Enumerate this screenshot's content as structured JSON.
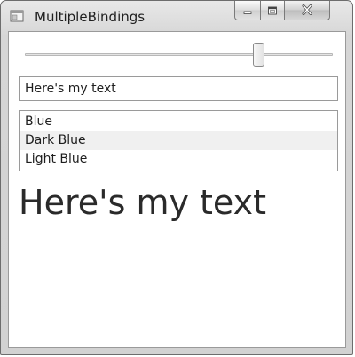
{
  "window": {
    "title": "MultipleBindings",
    "icon": "application-icon",
    "controls": {
      "minimize": "minimize-icon",
      "maximize": "maximize-icon",
      "close": "close-icon"
    }
  },
  "slider": {
    "value_fraction": 0.77
  },
  "text_box": {
    "value": "Here's my text"
  },
  "list_box": {
    "items": [
      "Blue",
      "Dark Blue",
      "Light Blue"
    ],
    "highlighted_index": 1
  },
  "display_text": "Here's my text"
}
